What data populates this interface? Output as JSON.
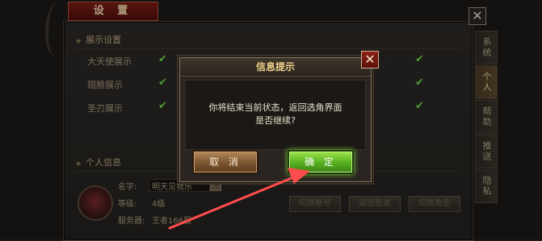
{
  "window": {
    "title": "设 置",
    "close_glyph": "✕"
  },
  "side_tabs": [
    {
      "label": "系统",
      "active": false
    },
    {
      "label": "个人",
      "active": true
    },
    {
      "label": "帮助",
      "active": false
    },
    {
      "label": "推送",
      "active": false
    },
    {
      "label": "隐私",
      "active": false
    }
  ],
  "display_settings": {
    "title": "展示设置",
    "options": [
      {
        "label": "大天使展示",
        "checked": true
      },
      {
        "label": "翅膀展示",
        "checked": true
      },
      {
        "label": "圣刃展示",
        "checked": true
      }
    ],
    "check_glyph": "✔"
  },
  "personal_info": {
    "title": "个人信息",
    "name_label": "名字:",
    "name_value": "明天见我乐",
    "level_label": "等级:",
    "level_value": "4级",
    "server_label": "服务器:",
    "server_value": "王者166服",
    "buttons": [
      "切换账号",
      "返回登录",
      "切换角色"
    ]
  },
  "dialog": {
    "title": "信息提示",
    "message_line1": "你将结束当前状态，返回选角界面",
    "message_line2": "是否继续?",
    "cancel_label": "取 消",
    "ok_label": "确 定",
    "close_glyph": "✕"
  },
  "colors": {
    "accent_green": "#55ae1f",
    "title_gold": "#f0d28a",
    "annotation_red": "#ff4d4d"
  }
}
